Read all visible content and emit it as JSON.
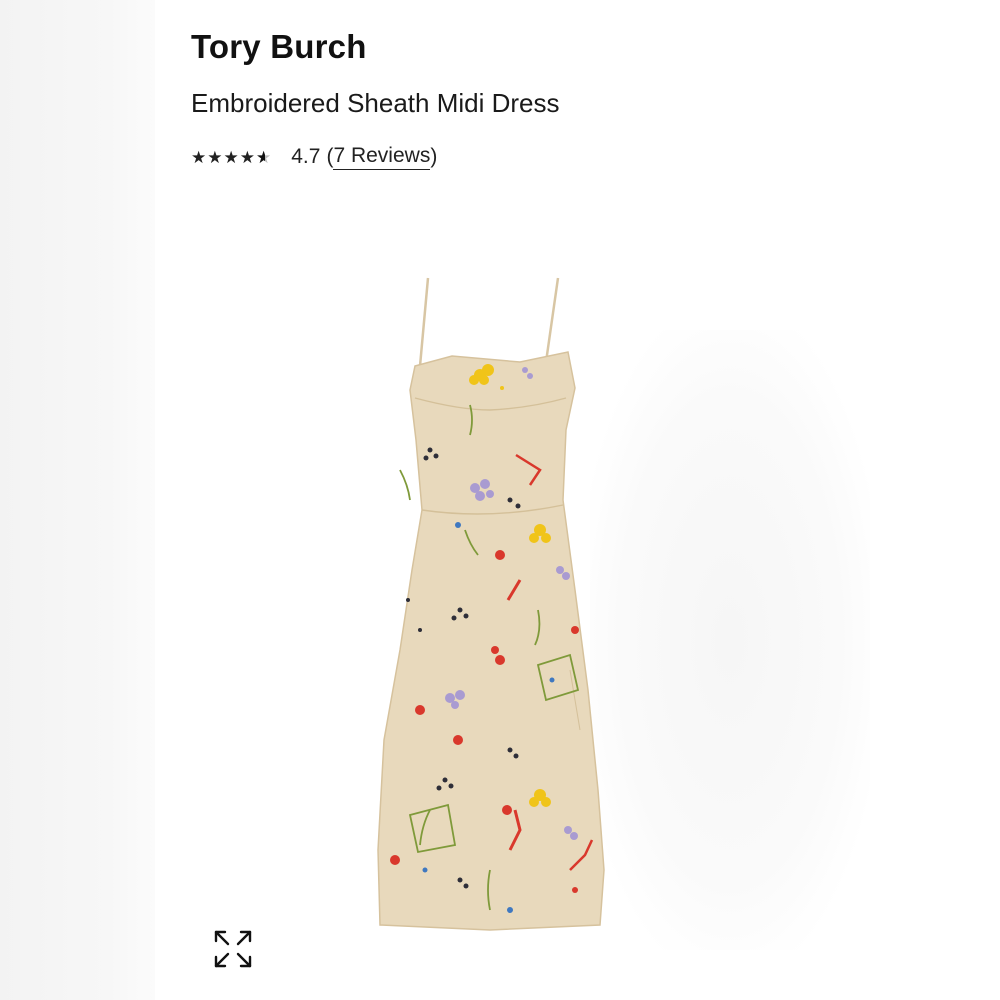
{
  "product": {
    "brand": "Tory Burch",
    "title": "Embroidered Sheath Midi Dress",
    "rating": {
      "stars_filled": 4.7,
      "stars_max": 5,
      "value_text": "4.7",
      "open_paren": "(",
      "reviews_text": "7 Reviews",
      "close_paren": ")"
    }
  },
  "image": {
    "alt": "Embroidered Sheath Midi Dress",
    "dress_color": "#e8d9bc",
    "accent_colors": [
      "#f0c419",
      "#d9382c",
      "#9b8fc9",
      "#2e2e38",
      "#7f9a3a",
      "#3f78c0"
    ]
  },
  "controls": {
    "expand_icon": "expand-arrows-icon"
  }
}
